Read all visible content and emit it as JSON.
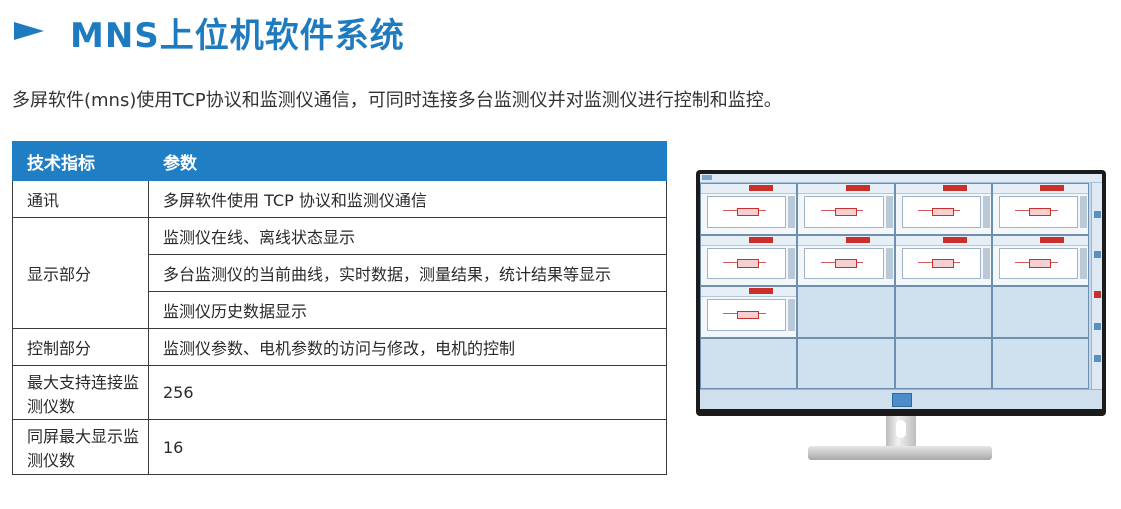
{
  "header": {
    "title": "MNS上位机软件系统",
    "intro": "多屏软件(mns)使用TCP协议和监测仪通信，可同时连接多台监测仪并对监测仪进行控制和监控。"
  },
  "table": {
    "headers": [
      "技术指标",
      "参数"
    ],
    "rows": [
      {
        "label": "通讯",
        "values": [
          "多屏软件使用 TCP 协议和监测仪通信"
        ]
      },
      {
        "label": "显示部分",
        "values": [
          "监测仪在线、离线状态显示",
          "多台监测仪的当前曲线，实时数据，测量结果，统计结果等显示",
          "监测仪历史数据显示"
        ]
      },
      {
        "label": "控制部分",
        "values": [
          "监测仪参数、电机参数的访问与修改，电机的控制"
        ]
      },
      {
        "label": "最大支持连接监测仪数",
        "values": [
          "256"
        ]
      },
      {
        "label": "同屏最大显示监测仪数",
        "values": [
          "16"
        ]
      }
    ]
  },
  "monitor": {
    "panels_total": 16,
    "panels_active": 9,
    "accent_color": "#c9302c"
  },
  "colors": {
    "brand": "#1e7bc0",
    "table_header": "#1f7ec4"
  }
}
